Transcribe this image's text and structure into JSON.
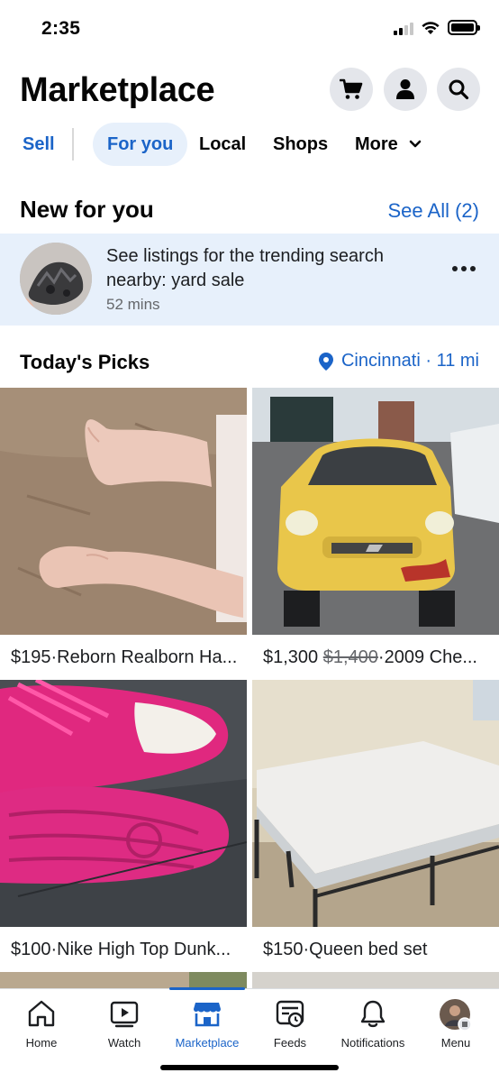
{
  "status_bar": {
    "time": "2:35"
  },
  "header": {
    "title": "Marketplace",
    "buttons": [
      {
        "name": "cart",
        "icon": "cart-icon"
      },
      {
        "name": "profile",
        "icon": "person-icon"
      },
      {
        "name": "search",
        "icon": "search-icon"
      }
    ]
  },
  "nav": {
    "sell": "Sell",
    "for_you": "For you",
    "local": "Local",
    "shops": "Shops",
    "more": "More"
  },
  "new_for_you": {
    "title": "New for you",
    "see_all": "See All (2)",
    "card": {
      "text": "See listings for the trending search nearby: yard sale",
      "time": "52 mins"
    }
  },
  "todays_picks": {
    "title": "Today's Picks",
    "location": "Cincinnati · 11 mi"
  },
  "listings": [
    {
      "price": "$195",
      "sep": " · ",
      "title": "Reborn Realborn Ha...",
      "old_price": ""
    },
    {
      "price": "$1,300",
      "sep": " · ",
      "title": "2009 Che...",
      "old_price": "$1,400"
    },
    {
      "price": "$100",
      "sep": " · ",
      "title": "Nike High Top Dunk...",
      "old_price": ""
    },
    {
      "price": "$150",
      "sep": " · ",
      "title": "Queen bed set",
      "old_price": ""
    }
  ],
  "tabs": [
    {
      "label": "Home",
      "icon": "home-icon"
    },
    {
      "label": "Watch",
      "icon": "video-icon"
    },
    {
      "label": "Marketplace",
      "icon": "shop-icon",
      "active": true
    },
    {
      "label": "Feeds",
      "icon": "feeds-icon"
    },
    {
      "label": "Notifications",
      "icon": "bell-icon"
    },
    {
      "label": "Menu",
      "icon": "avatar-menu-icon"
    }
  ],
  "colors": {
    "accent": "#1b64c8",
    "pill_bg": "#e7f0fb",
    "icon_button_bg": "#e4e6eb"
  }
}
